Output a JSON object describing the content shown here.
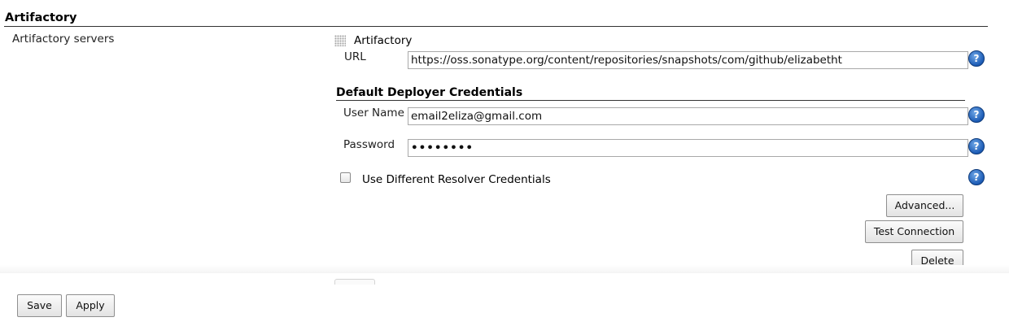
{
  "section": {
    "title": "Artifactory"
  },
  "servers_row": {
    "label": "Artifactory servers"
  },
  "server": {
    "name": "Artifactory",
    "url_label": "URL",
    "url_value": "https://oss.sonatype.org/content/repositories/snapshots/com/github/elizabetht"
  },
  "deployer": {
    "heading": "Default Deployer Credentials",
    "username_label": "User Name",
    "username_value": "email2eliza@gmail.com",
    "password_label": "Password",
    "password_value": "••••••••"
  },
  "resolver": {
    "checkbox_label": "Use Different Resolver Credentials",
    "checked": false
  },
  "buttons": {
    "advanced": "Advanced...",
    "test_connection": "Test Connection",
    "delete": "Delete",
    "save": "Save",
    "apply": "Apply"
  },
  "icons": {
    "help": "help-icon",
    "help_glyph": "?",
    "drag": "drag-handle-icon"
  },
  "colors": {
    "help_blue": "#1c5bb5",
    "rule": "#333333"
  }
}
